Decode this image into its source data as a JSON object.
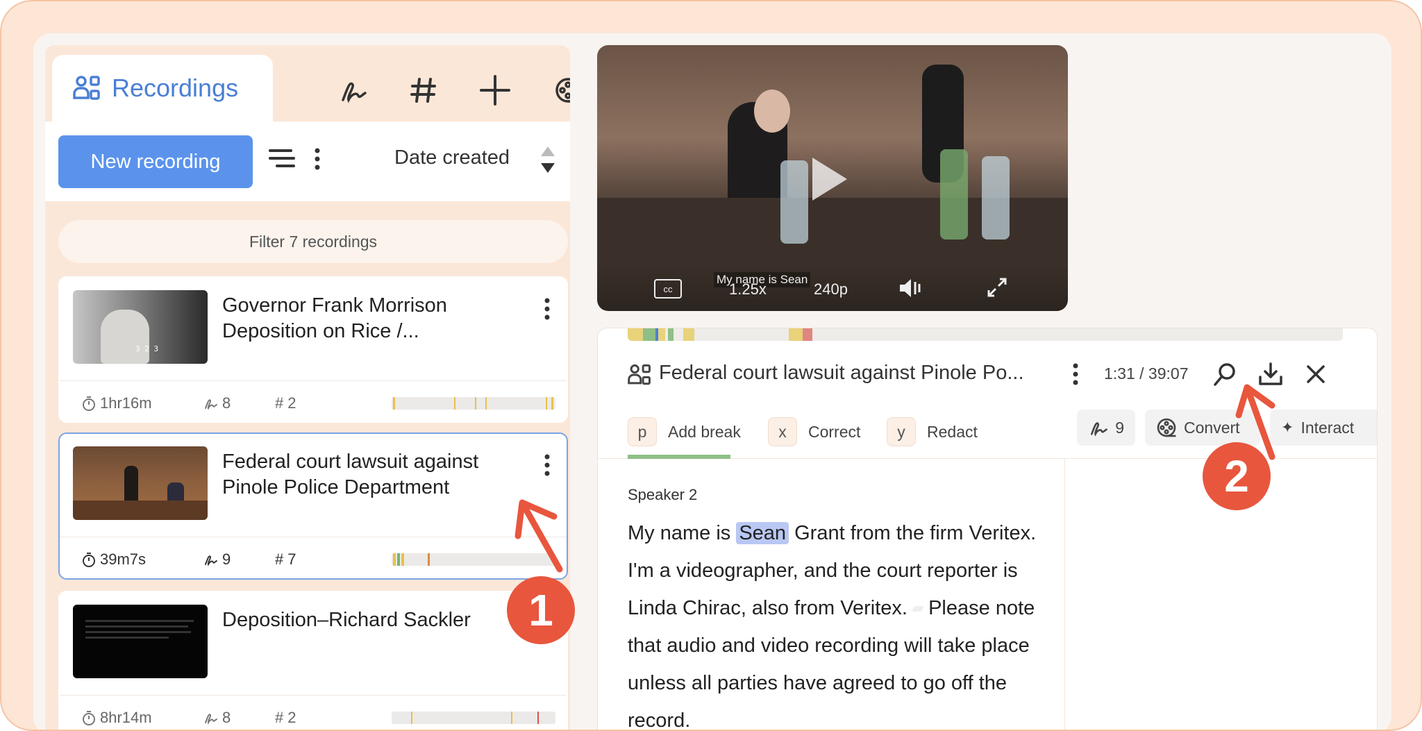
{
  "tabs": {
    "recordings_label": "Recordings",
    "icons": [
      "signature-icon",
      "hash-icon",
      "plus-icon",
      "film-reel-icon"
    ]
  },
  "toolbar": {
    "new_recording_label": "New recording",
    "sort_label": "Date created"
  },
  "filter": {
    "placeholder": "Filter 7 recordings"
  },
  "recordings": [
    {
      "title": "Governor Frank Morrison Deposition on Rice /...",
      "duration": "1hr16m",
      "signatures": "8",
      "tags": "2",
      "thumb_caption": "3 2 3"
    },
    {
      "title": "Federal court lawsuit against Pinole Police Department",
      "duration": "39m7s",
      "signatures": "9",
      "tags": "7"
    },
    {
      "title": "Deposition–Richard Sackler",
      "duration": "8hr14m",
      "signatures": "8",
      "tags": "2"
    }
  ],
  "video": {
    "caption": "My name is Sean",
    "speed": "1.25x",
    "quality": "240p",
    "cc_label": "cc"
  },
  "detail": {
    "title": "Federal court lawsuit against Pinole Po...",
    "time": "1:31 / 39:07",
    "actions": [
      {
        "key": "p",
        "label": "Add break"
      },
      {
        "key": "x",
        "label": "Correct"
      },
      {
        "key": "y",
        "label": "Redact"
      }
    ],
    "signature_count": "9",
    "convert_label": "Convert",
    "interact_label": "Interact",
    "speaker": "Speaker 2",
    "transcript": {
      "pre": "My name is ",
      "highlight": "Sean",
      "post": " Grant from the firm Veritex. I'm a videographer, and the court reporter is Linda Chirac, also from Veritex.",
      "post2": " Please note that audio and video recording will take place unless all parties have agreed to go off the record."
    }
  },
  "callouts": {
    "one": "1",
    "two": "2"
  },
  "colors": {
    "accent": "#5b93ec",
    "callout": "#e8563d",
    "frame_bg": "#fde6d5"
  }
}
